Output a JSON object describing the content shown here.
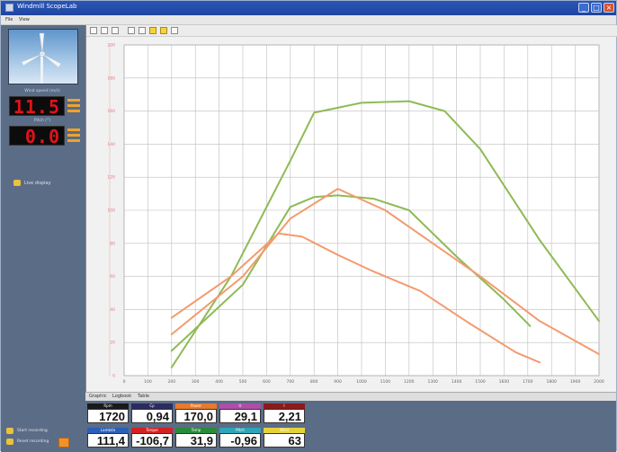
{
  "window": {
    "title": "Windmill ScopeLab",
    "controls": {
      "minimize": "_",
      "maximize": "□",
      "close": "×"
    }
  },
  "menu": {
    "items": [
      "File",
      "View"
    ]
  },
  "left_panel": {
    "display_1": {
      "label": "Wind speed (m/s)",
      "value": "11.5"
    },
    "display_2": {
      "label": "Pitch (°)",
      "value": "0.0"
    },
    "options": [
      {
        "label": "Live display",
        "icon": "toggle-icon"
      }
    ]
  },
  "tabs": [
    "Graphic",
    "Logbook",
    "Table"
  ],
  "bottom_left": [
    {
      "label": "Start recording"
    },
    {
      "label": "Reset recording"
    }
  ],
  "meters": [
    {
      "label": "Rpm",
      "value": "1720",
      "color": "#1a1a1a"
    },
    {
      "label": "Cp",
      "value": "0,94",
      "color": "#2b2b60"
    },
    {
      "label": "Power",
      "value": "170,0",
      "color": "#e87a2e"
    },
    {
      "label": "U",
      "value": "29,1",
      "color": "#b04da8"
    },
    {
      "label": "I",
      "value": "2,21",
      "color": "#8c1a1a"
    },
    {
      "label": "Lambda",
      "value": "111,4",
      "color": "#2a5fb8"
    },
    {
      "label": "Torque",
      "value": "-106,7",
      "color": "#d22222"
    },
    {
      "label": "Temp",
      "value": "31,9",
      "color": "#2a8a3a"
    },
    {
      "label": "Pitch",
      "value": "-0,96",
      "color": "#2ea5b8"
    },
    {
      "label": "Wind",
      "value": "63",
      "color": "#e5d23a"
    }
  ],
  "chart_data": {
    "type": "line",
    "title": "",
    "xlabel": "",
    "ylabel": "",
    "xlim": [
      0,
      2000
    ],
    "ylim": [
      0,
      200
    ],
    "x_ticks": [
      0,
      100,
      200,
      300,
      400,
      500,
      600,
      700,
      800,
      900,
      1000,
      1100,
      1200,
      1300,
      1400,
      1500,
      1600,
      1700,
      1800,
      1900,
      2000
    ],
    "y_ticks": [
      0,
      20,
      40,
      60,
      80,
      100,
      120,
      140,
      160,
      180,
      200
    ],
    "grid": true,
    "series": [
      {
        "color": "#8fba56",
        "points": [
          [
            200,
            5
          ],
          [
            450,
            60
          ],
          [
            700,
            130
          ],
          [
            800,
            159
          ],
          [
            1000,
            165
          ],
          [
            1200,
            166
          ],
          [
            1350,
            160
          ],
          [
            1500,
            137
          ],
          [
            1750,
            82
          ],
          [
            2000,
            33
          ]
        ]
      },
      {
        "color": "#8fba56",
        "points": [
          [
            200,
            15
          ],
          [
            500,
            55
          ],
          [
            700,
            102
          ],
          [
            800,
            108
          ],
          [
            900,
            109
          ],
          [
            1050,
            107
          ],
          [
            1200,
            100
          ],
          [
            1400,
            72
          ],
          [
            1600,
            46
          ],
          [
            1710,
            30
          ]
        ]
      },
      {
        "color": "#f39b6e",
        "points": [
          [
            200,
            25
          ],
          [
            500,
            60
          ],
          [
            700,
            95
          ],
          [
            900,
            113
          ],
          [
            1100,
            100
          ],
          [
            1300,
            80
          ],
          [
            1500,
            60
          ],
          [
            1750,
            33
          ],
          [
            2000,
            13
          ]
        ]
      },
      {
        "color": "#f39b6e",
        "points": [
          [
            200,
            35
          ],
          [
            450,
            60
          ],
          [
            650,
            86
          ],
          [
            750,
            84
          ],
          [
            900,
            73
          ],
          [
            1050,
            63
          ],
          [
            1250,
            51
          ],
          [
            1450,
            32
          ],
          [
            1650,
            14
          ],
          [
            1750,
            8
          ]
        ]
      }
    ]
  }
}
